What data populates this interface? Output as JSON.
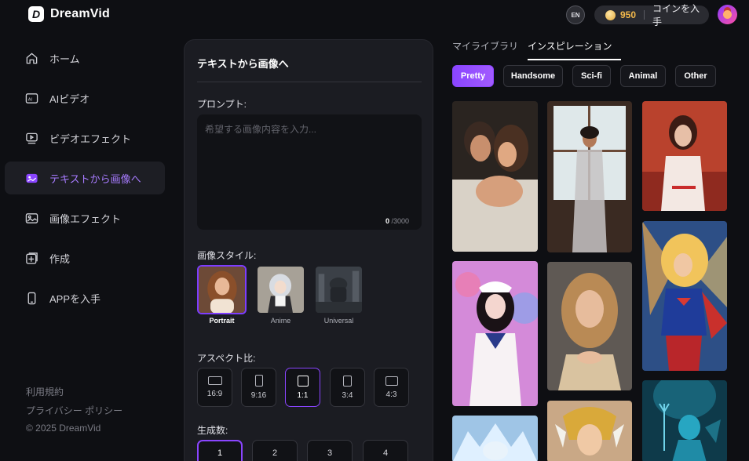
{
  "header": {
    "brand": "DreamVid",
    "lang_label": "EN",
    "coins": "950",
    "coin_cta": "コインを入手"
  },
  "sidebar": {
    "items": [
      {
        "label": "ホーム",
        "icon": "home-icon"
      },
      {
        "label": "AIビデオ",
        "icon": "ai-video-icon"
      },
      {
        "label": "ビデオエフェクト",
        "icon": "video-effect-icon"
      },
      {
        "label": "テキストから画像へ",
        "icon": "text-to-image-icon"
      },
      {
        "label": "画像エフェクト",
        "icon": "image-effect-icon"
      },
      {
        "label": "作成",
        "icon": "create-icon"
      },
      {
        "label": "APPを入手",
        "icon": "phone-icon"
      }
    ],
    "footer": {
      "terms": "利用規約",
      "privacy": "プライバシー ポリシー",
      "copyright": "© 2025 DreamVid"
    }
  },
  "panel": {
    "title": "テキストから画像へ",
    "prompt_label": "プロンプト:",
    "prompt_placeholder": "希望する画像内容を入力...",
    "prompt_count": "0",
    "prompt_max": "/3000",
    "style_label": "画像スタイル:",
    "styles": [
      "Portrait",
      "Anime",
      "Universal"
    ],
    "aspect_label": "アスペクト比:",
    "aspects": [
      "16:9",
      "9:16",
      "1:1",
      "3:4",
      "4:3"
    ],
    "count_label": "生成数:",
    "counts": [
      "1",
      "2",
      "3",
      "4"
    ]
  },
  "gallery": {
    "tabs": [
      "マイライブラリ",
      "インスピレーション"
    ],
    "categories": [
      "Pretty",
      "Handsome",
      "Sci-fi",
      "Animal",
      "Other"
    ]
  },
  "colors": {
    "accent": "#8a45ff",
    "accent_text": "#a77bff",
    "coin": "#f2b84b",
    "background": "#0e0f13",
    "panel": "#1b1c22"
  }
}
